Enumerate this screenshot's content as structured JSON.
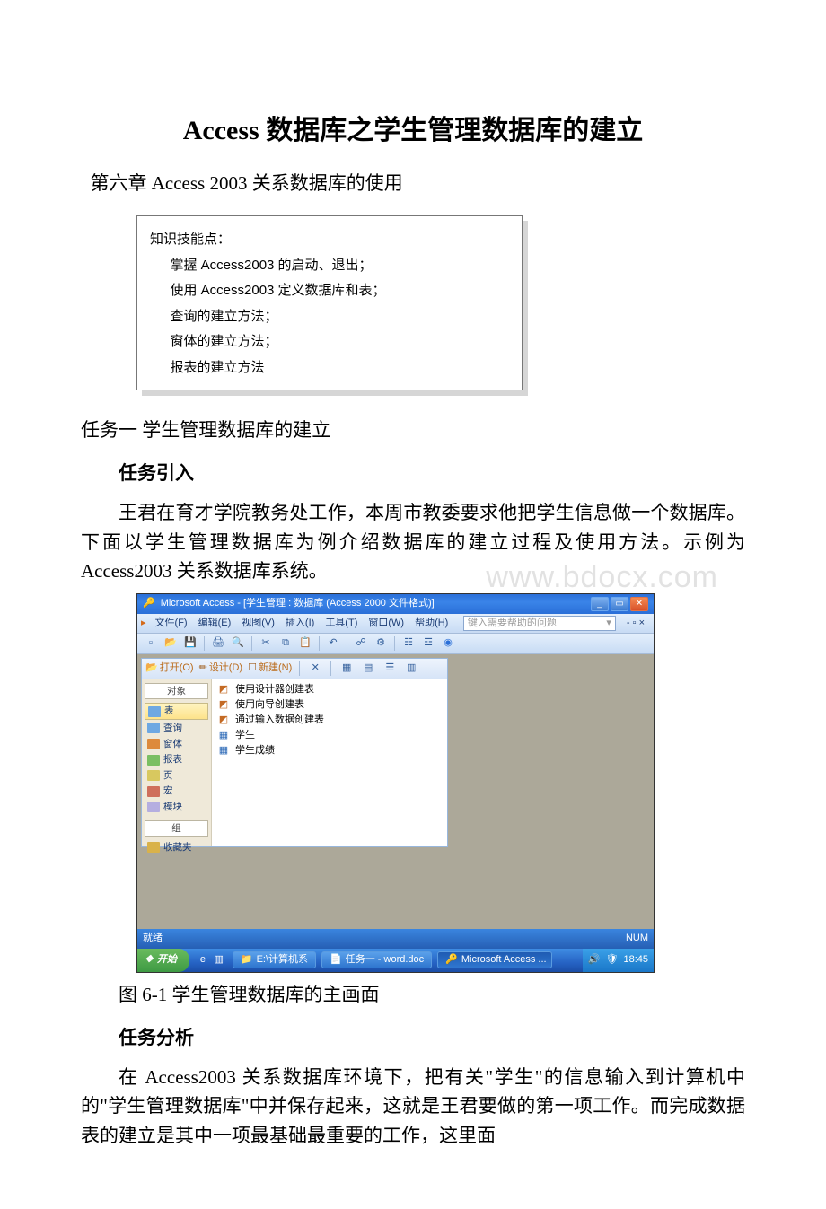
{
  "title": "Access 数据库之学生管理数据库的建立",
  "chapter": "第六章 Access 2003 关系数据库的使用",
  "skill_box": {
    "header": "知识技能点：",
    "items": [
      "掌握 Access2003 的启动、退出；",
      "使用 Access2003 定义数据库和表；",
      "查询的建立方法；",
      "窗体的建立方法；",
      "报表的建立方法"
    ]
  },
  "task_title": "任务一 学生管理数据库的建立",
  "intro_head": "任务引入",
  "intro_para": "王君在育才学院教务处工作，本周市教委要求他把学生信息做一个数据库。下面以学生管理数据库为例介绍数据库的建立过程及使用方法。示例为 Access2003 关系数据库系统。",
  "watermark": "www.bdocx.com",
  "screenshot": {
    "title": "Microsoft Access - [学生管理 : 数据库 (Access 2000 文件格式)]",
    "menus": [
      "文件(F)",
      "编辑(E)",
      "视图(V)",
      "插入(I)",
      "工具(T)",
      "窗口(W)",
      "帮助(H)"
    ],
    "help_placeholder": "键入需要帮助的问题",
    "db_tools": {
      "open": "打开(O)",
      "design": "设计(D)",
      "new": "新建(N)"
    },
    "side_header": "对象",
    "side_items": [
      "表",
      "查询",
      "窗体",
      "报表",
      "页",
      "宏",
      "模块"
    ],
    "side_group": "组",
    "side_fav": "收藏夹",
    "objects": [
      "使用设计器创建表",
      "使用向导创建表",
      "通过输入数据创建表",
      "学生",
      "学生成绩"
    ],
    "status_left": "就绪",
    "status_right": "NUM",
    "taskbar": {
      "start": "开始",
      "buttons": [
        "E:\\计算机系",
        "任务一 - word.doc",
        "Microsoft Access ..."
      ],
      "time": "18:45"
    }
  },
  "figure_caption": "图 6-1 学生管理数据库的主画面",
  "analysis_head": "任务分析",
  "analysis_para": "在 Access2003 关系数据库环境下，把有关\"学生\"的信息输入到计算机中的\"学生管理数据库\"中并保存起来，这就是王君要做的第一项工作。而完成数据表的建立是其中一项最基础最重要的工作，这里面"
}
